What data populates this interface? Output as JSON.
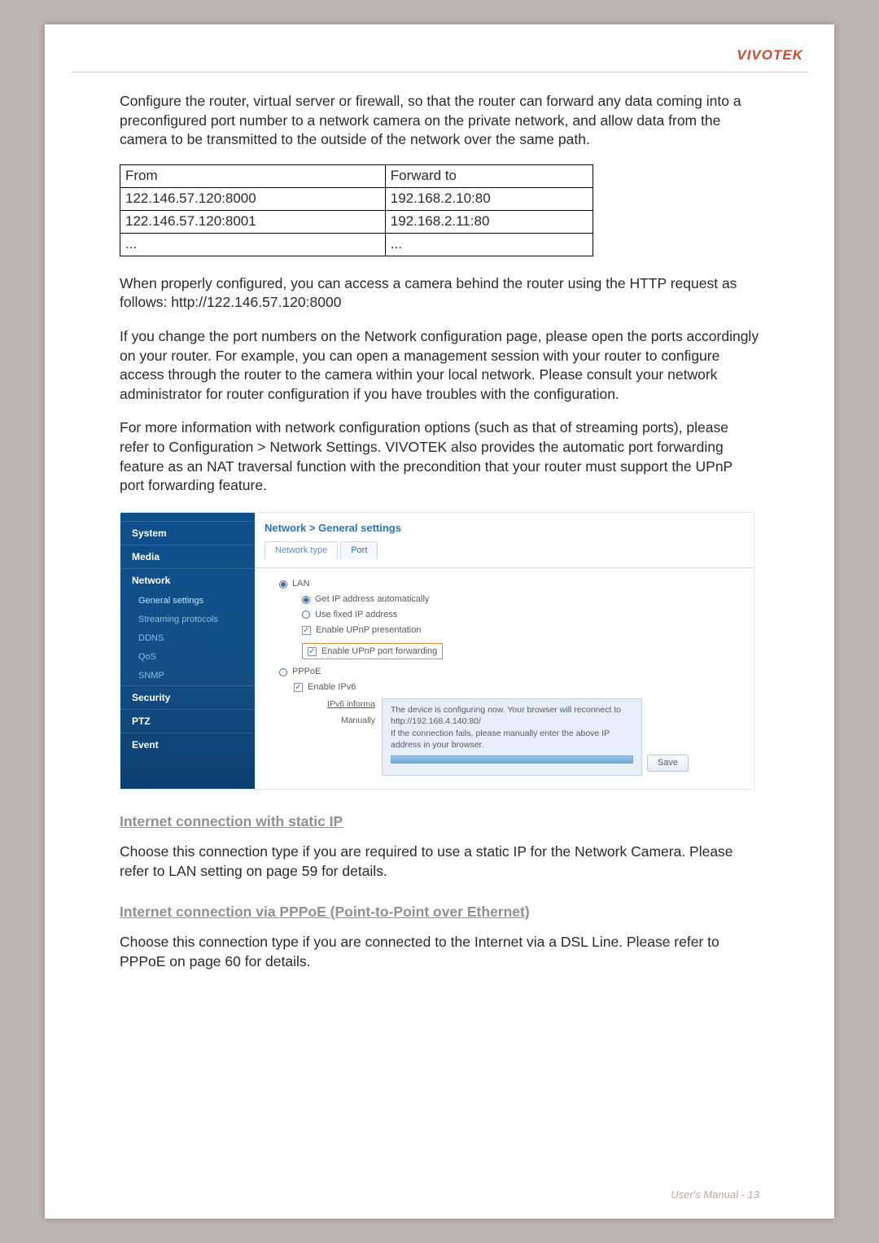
{
  "brand": "VIVOTEK",
  "intro": "Configure the router, virtual server or firewall, so that the router can forward any data coming into a preconfigured port number to a network camera on the private network, and allow data from the camera to be transmitted to the outside of the network over the same path.",
  "fwd_table": {
    "headers": [
      "From",
      "Forward to"
    ],
    "rows": [
      [
        "122.146.57.120:8000",
        "192.168.2.10:80"
      ],
      [
        "122.146.57.120:8001",
        "192.168.2.11:80"
      ],
      [
        "...",
        "..."
      ]
    ]
  },
  "para2": "When properly configured, you can access a camera behind the router using the HTTP request as follows: http://122.146.57.120:8000",
  "para3": "If you change the port numbers on the Network configuration page, please open the ports accordingly on your router. For example, you can open a management session with your router to configure access through the router to the camera within your local network. Please consult your network administrator for router configuration if you have troubles with the configuration.",
  "para4": "For more information with network configuration options (such as that of streaming ports), please refer to Configuration > Network Settings. VIVOTEK also provides the automatic port forwarding feature as an NAT traversal function with the precondition that your router must support the UPnP port forwarding feature.",
  "screenshot": {
    "crumbs": "Network  >  General settings",
    "tabs": {
      "t1": "Network type",
      "t2": "Port"
    },
    "sidebar": {
      "system": "System",
      "media": "Media",
      "network": "Network",
      "subs": {
        "general": "General settings",
        "streaming": "Streaming protocols",
        "ddns": "DDNS",
        "qos": "QoS",
        "snmp": "SNMP"
      },
      "security": "Security",
      "ptz": "PTZ",
      "event": "Event"
    },
    "lan": "LAN",
    "auto": "Get IP address automatically",
    "fixed": "Use fixed IP address",
    "upnp_pres": "Enable UPnP presentation",
    "upnp_fwd": "Enable UPnP port forwarding",
    "pppoe": "PPPoE",
    "ipv6_enable": "Enable IPv6",
    "ipv6_info_label": "IPv6 informa",
    "manually_label": "Manually",
    "tip1": "The device is configuring now. Your browser will reconnect to http://192.168.4.140:80/",
    "tip2": "If the connection fails, please manually enter the above IP address in your browser.",
    "save": "Save"
  },
  "h2a": "Internet connection with static IP",
  "para5": "Choose this connection type if you are required to use a static IP for the Network Camera. Please refer to LAN setting on page 59 for details.",
  "h2b": "Internet connection via PPPoE (Point-to-Point over Ethernet)",
  "para6": "Choose this connection type if you are connected to the Internet via a DSL Line. Please refer to PPPoE on page 60 for details.",
  "footer": "User's Manual - 13"
}
